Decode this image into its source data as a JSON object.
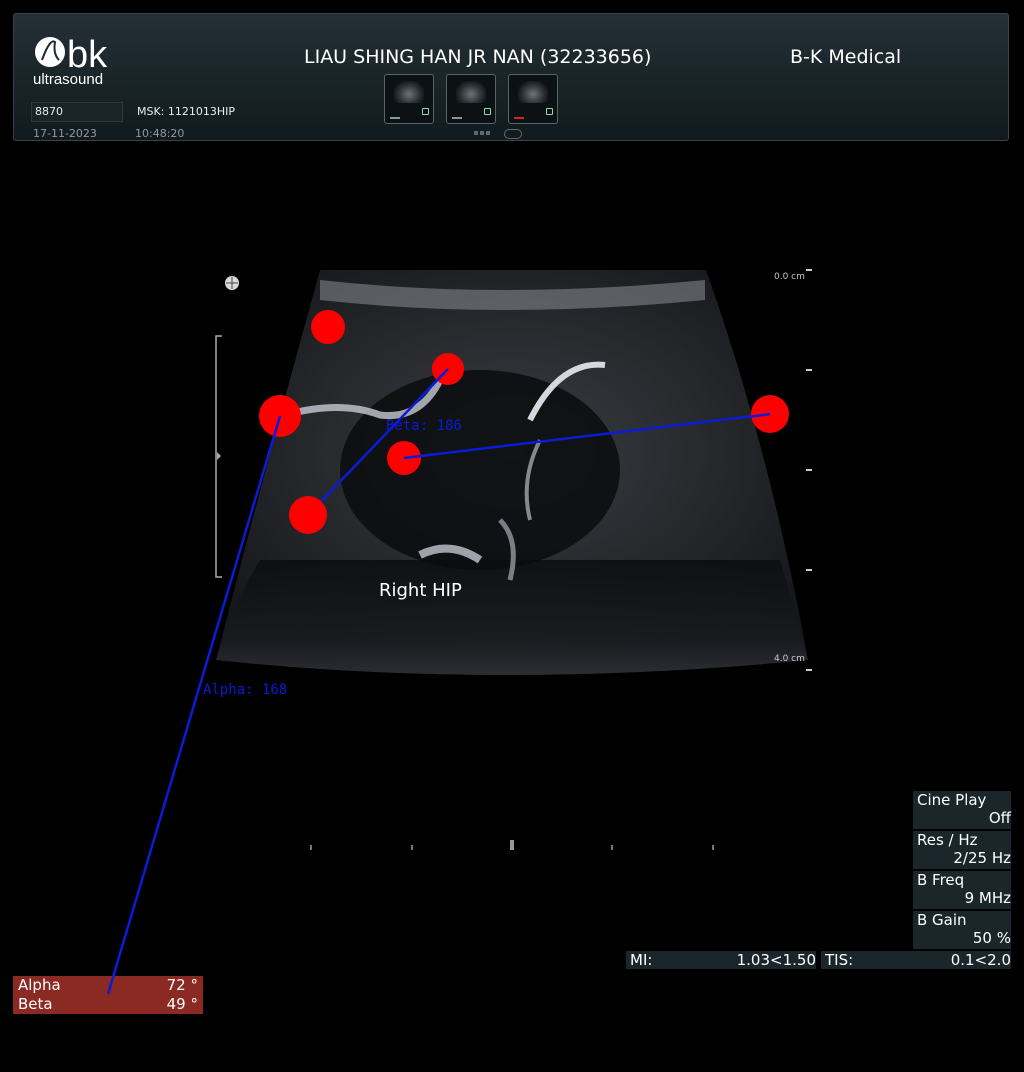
{
  "header": {
    "logo_text": "bk",
    "logo_subtext": "ultrasound",
    "patient": "LIAU SHING HAN JR NAN (32233656)",
    "hospital": "B-K Medical",
    "id": "8870",
    "exam": "MSK: 1121013HIP",
    "date": "17-11-2023",
    "time": "10:48:20",
    "thumbnails": [
      {
        "icon": "ultrasound-thumbnail-icon"
      },
      {
        "icon": "ultrasound-thumbnail-icon"
      },
      {
        "icon": "ultrasound-thumbnail-icon"
      }
    ]
  },
  "image": {
    "depth_top": "0.0 cm",
    "depth_bottom": "4.0 cm",
    "region_label": "Right HIP",
    "beta_label": "Beta: 186",
    "alpha_label": "Alpha: 168"
  },
  "params": [
    {
      "key": "Cine Play",
      "value": "Off"
    },
    {
      "key": "Res / Hz",
      "value": "2/25 Hz"
    },
    {
      "key": "B Freq",
      "value": "9 MHz"
    },
    {
      "key": "B Gain",
      "value": "50 %"
    }
  ],
  "safety": {
    "mi_key": "MI:",
    "mi_value": "1.03<1.50",
    "tis_key": "TIS:",
    "tis_value": "0.1<2.0"
  },
  "angles": [
    {
      "key": "Alpha",
      "value": "72 °"
    },
    {
      "key": "Beta",
      "value": "49 °"
    }
  ],
  "colors": {
    "marker": "#ff0000",
    "line": "#0a1cd6",
    "angle_box": "#8b2923"
  }
}
